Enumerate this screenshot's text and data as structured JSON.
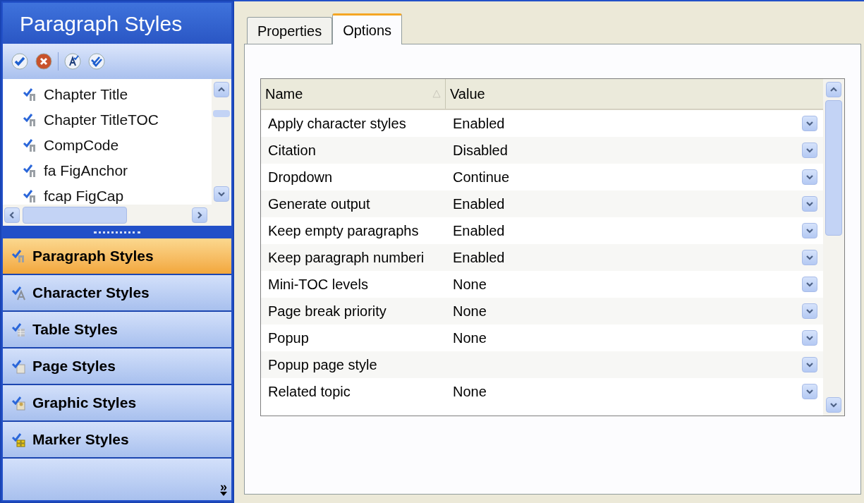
{
  "sidebar": {
    "title": "Paragraph Styles",
    "toolbar": [
      {
        "kind": "check"
      },
      {
        "kind": "remove"
      },
      {
        "kind": "separator"
      },
      {
        "kind": "font"
      },
      {
        "kind": "double-check"
      }
    ],
    "tree": [
      {
        "label": "Chapter Title"
      },
      {
        "label": "Chapter TitleTOC"
      },
      {
        "label": "CompCode"
      },
      {
        "label": "fa FigAnchor"
      },
      {
        "label": "fcap FigCap"
      }
    ],
    "nav": [
      {
        "label": "Paragraph Styles",
        "selected": true,
        "kind": "paragraph"
      },
      {
        "label": "Character Styles",
        "selected": false,
        "kind": "character"
      },
      {
        "label": "Table Styles",
        "selected": false,
        "kind": "table"
      },
      {
        "label": "Page Styles",
        "selected": false,
        "kind": "page"
      },
      {
        "label": "Graphic Styles",
        "selected": false,
        "kind": "graphic"
      },
      {
        "label": "Marker Styles",
        "selected": false,
        "kind": "marker"
      }
    ],
    "more": "»"
  },
  "tabs": [
    {
      "label": "Properties",
      "selected": false
    },
    {
      "label": "Options",
      "selected": true
    }
  ],
  "grid": {
    "columns": [
      "Name",
      "Value"
    ],
    "rows": [
      {
        "name": "Apply character styles",
        "value": "Enabled"
      },
      {
        "name": "Citation",
        "value": "Disabled"
      },
      {
        "name": "Dropdown",
        "value": "Continue"
      },
      {
        "name": "Generate output",
        "value": "Enabled"
      },
      {
        "name": "Keep empty paragraphs",
        "value": "Enabled"
      },
      {
        "name": "Keep paragraph numberi",
        "value": "Enabled"
      },
      {
        "name": "Mini-TOC levels",
        "value": "None"
      },
      {
        "name": "Page break priority",
        "value": "None"
      },
      {
        "name": "Popup",
        "value": "None"
      },
      {
        "name": "Popup page style"
      },
      {
        "name": "Related topic",
        "value": "None"
      }
    ]
  }
}
